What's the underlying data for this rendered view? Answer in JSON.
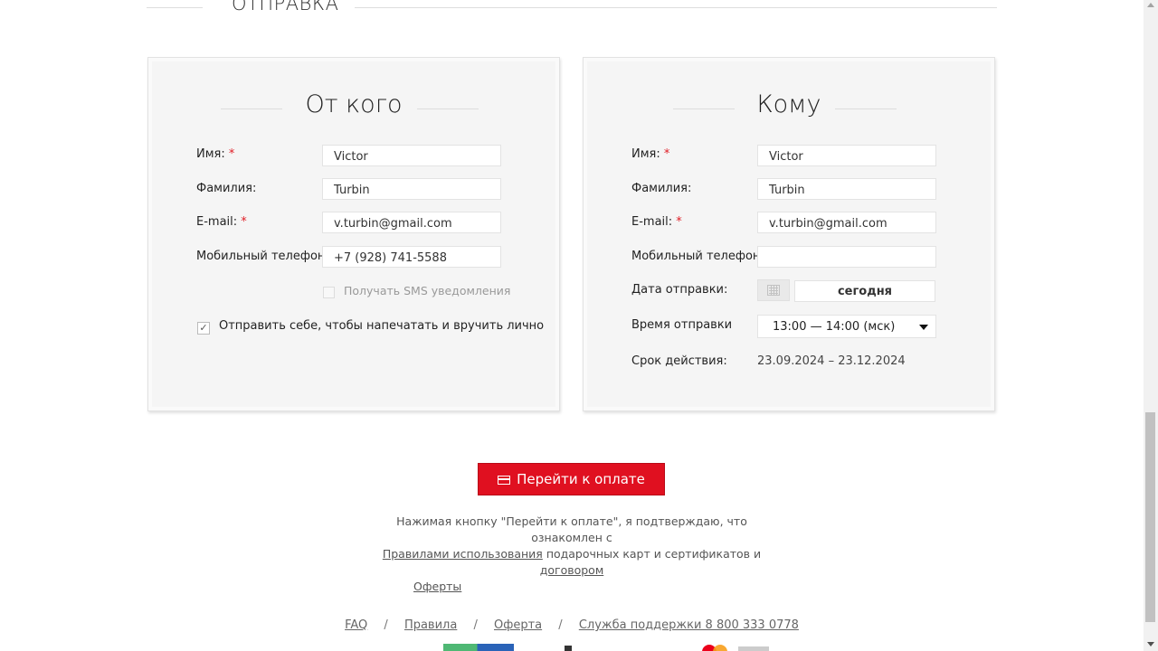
{
  "section": {
    "title": "ОТПРАВКА"
  },
  "sender": {
    "title": "От кого",
    "name_label": "Имя:",
    "name_value": "Victor",
    "surname_label": "Фамилия:",
    "surname_value": "Turbin",
    "email_label": "E-mail:",
    "email_value": "v.turbin@gmail.com",
    "phone_label": "Мобильный телефон:",
    "phone_value": "+7 (928) 741-5588",
    "sms_label": "Получать SMS уведомления",
    "sms_checked": false,
    "self_send_label": "Отправить себе, чтобы напечатать и вручить лично",
    "self_send_checked": true,
    "required_mark": "*"
  },
  "recipient": {
    "title": "Кому",
    "name_label": "Имя:",
    "name_value": "Victor",
    "surname_label": "Фамилия:",
    "surname_value": "Turbin",
    "email_label": "E-mail:",
    "email_value": "v.turbin@gmail.com",
    "phone_label": "Мобильный телефон:",
    "phone_value": "",
    "date_label": "Дата отправки:",
    "date_value": "сегодня",
    "time_label": "Время отправки",
    "time_value": "13:00 — 14:00 (мск)",
    "validity_label": "Срок действия:",
    "validity_value": "23.09.2024 – 23.12.2024",
    "required_mark": "*"
  },
  "pay_button": {
    "label": "Перейти к оплате"
  },
  "agreement": {
    "text_1": "Нажимая кнопку \"Перейти к оплате\", я подтверждаю, что ознакомлен с",
    "link_rules": "Правилами использования",
    "text_2": "подарочных карт и сертификатов и",
    "link_offer_1": "договором",
    "link_offer_2": "Оферты"
  },
  "footer": {
    "links": [
      "FAQ",
      "Правила",
      "Оферта",
      "Служба поддержки 8 800 333 0778"
    ],
    "separator": "/"
  },
  "colors": {
    "accent": "#e01020",
    "required": "#e01c24",
    "panel_bg": "#f5f5f5"
  }
}
